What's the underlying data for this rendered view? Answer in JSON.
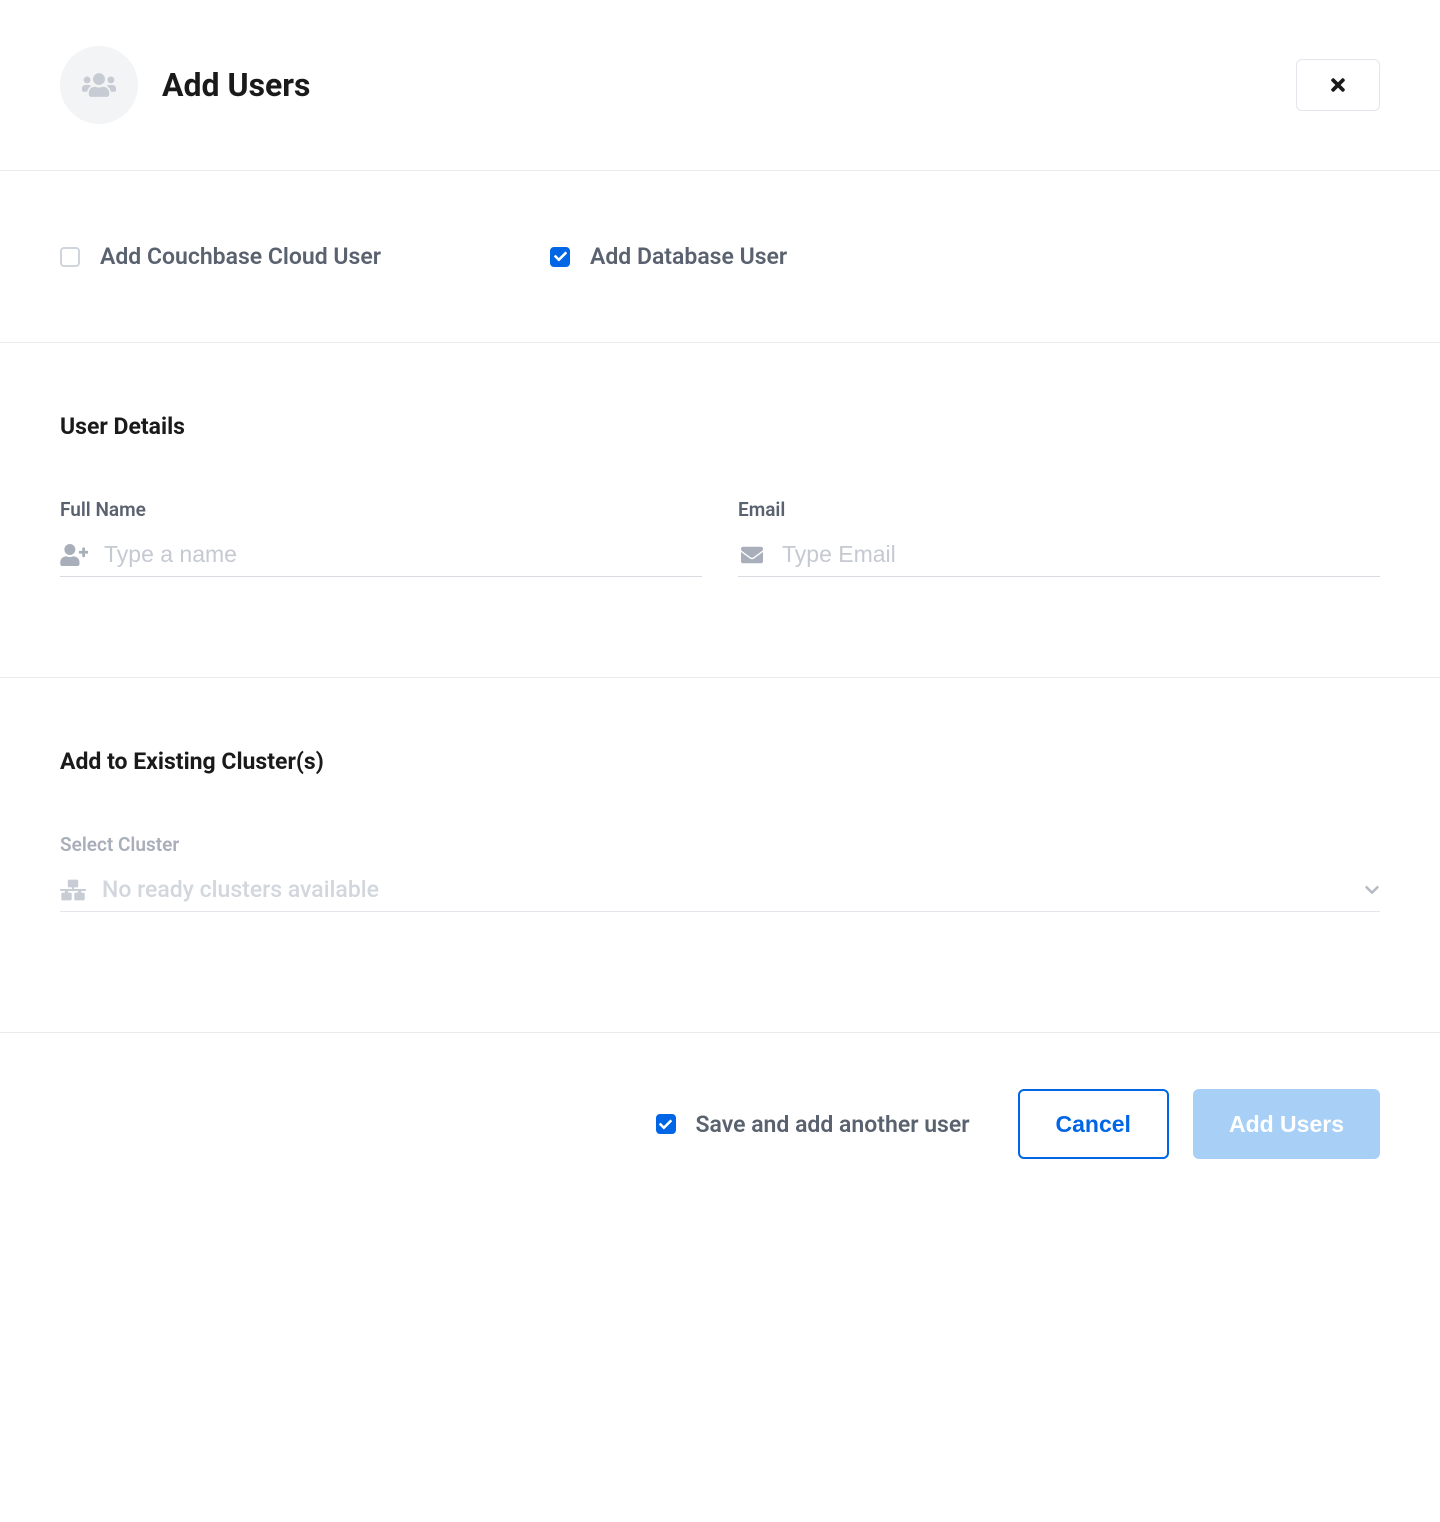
{
  "header": {
    "title": "Add Users"
  },
  "userTypes": {
    "cloudUser": {
      "label": "Add Couchbase Cloud User",
      "checked": false
    },
    "databaseUser": {
      "label": "Add Database User",
      "checked": true
    }
  },
  "userDetails": {
    "heading": "User Details",
    "fullName": {
      "label": "Full Name",
      "placeholder": "Type a name",
      "value": ""
    },
    "email": {
      "label": "Email",
      "placeholder": "Type Email",
      "value": ""
    }
  },
  "clusterSection": {
    "heading": "Add to Existing Cluster(s)",
    "selectLabel": "Select Cluster",
    "placeholder": "No ready clusters available"
  },
  "footer": {
    "saveAnother": {
      "label": "Save and add another user",
      "checked": true
    },
    "cancelLabel": "Cancel",
    "submitLabel": "Add Users"
  }
}
